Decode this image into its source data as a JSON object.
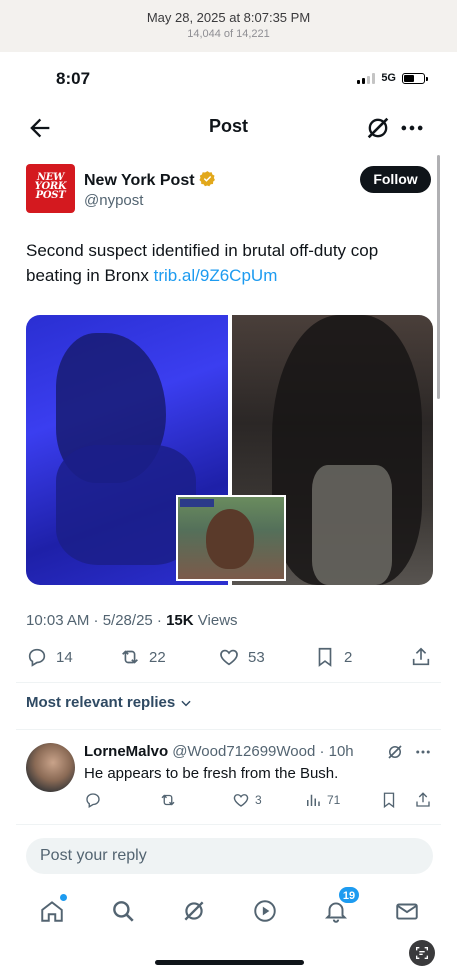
{
  "photo_header": {
    "date": "May 28, 2025 at 8:07:35 PM",
    "count": "14,044 of 14,221"
  },
  "status_bar": {
    "time": "8:07",
    "network": "5G"
  },
  "nav": {
    "title": "Post",
    "back_icon": "back-arrow-icon",
    "grok_icon": "grok-icon",
    "more_icon": "more-icon"
  },
  "post": {
    "author_name": "New York Post",
    "author_handle": "@nypost",
    "avatar_lines": [
      "NEW",
      "YORK",
      "POST"
    ],
    "follow_label": "Follow",
    "text": "Second suspect identified in brutal off-duty cop beating in Bronx ",
    "link": "trib.al/9Z6CpUm",
    "time": "10:03 AM · 5/28/25 · ",
    "views_count": "15K",
    "views_label": " Views",
    "replies": "14",
    "reposts": "22",
    "likes": "53",
    "bookmarks": "2"
  },
  "replies_filter": "Most relevant replies",
  "reply": {
    "name": "LorneMalvo",
    "handle": "@Wood712699Wood · 10h",
    "text": "He appears to be fresh from the Bush.",
    "likes": "3",
    "views": "71"
  },
  "compose_placeholder": "Post your reply",
  "tabbar": {
    "notifications_badge": "19"
  },
  "colors": {
    "accent": "#1d9bf0",
    "nyp_red": "#d4191f",
    "text": "#0f1419",
    "muted": "#536471"
  }
}
